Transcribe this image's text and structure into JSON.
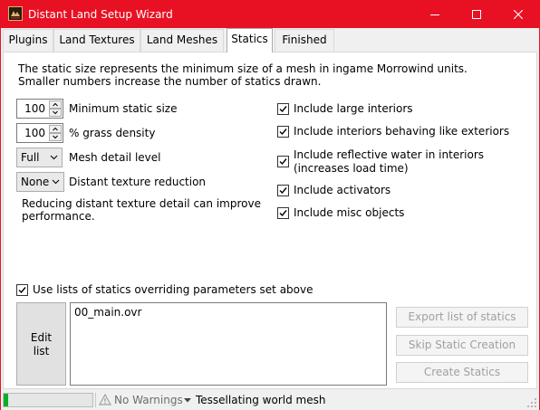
{
  "window": {
    "title": "Distant Land Setup Wizard",
    "icon": "app-icon",
    "accent_color": "#e81123",
    "controls": [
      "minimize-icon",
      "maximize-icon",
      "close-icon"
    ]
  },
  "tabs": [
    {
      "label": "Plugins",
      "active": false
    },
    {
      "label": "Land Textures",
      "active": false
    },
    {
      "label": "Land Meshes",
      "active": false
    },
    {
      "label": "Statics",
      "active": true
    },
    {
      "label": "Finished",
      "active": false
    }
  ],
  "statics": {
    "description_line1": "The static size represents the minimum size of a mesh in ingame Morrowind units.",
    "description_line2": "Smaller numbers increase the number of statics drawn.",
    "min_static_size": {
      "value": "100",
      "label": "Minimum static size"
    },
    "grass_density": {
      "value": "100",
      "label": "% grass density"
    },
    "mesh_detail": {
      "value": "Full",
      "label": "Mesh detail level"
    },
    "texture_reduction": {
      "value": "None",
      "label": "Distant texture reduction"
    },
    "reduction_note_line1": "Reducing distant texture detail can improve",
    "reduction_note_line2": "performance.",
    "options": [
      {
        "label": "Include large interiors",
        "checked": true
      },
      {
        "label": "Include interiors behaving like exteriors",
        "checked": true
      },
      {
        "label": "Include reflective water in interiors",
        "label2": "(increases load time)",
        "checked": true
      },
      {
        "label": "Include activators",
        "checked": true
      },
      {
        "label": "Include misc objects",
        "checked": true
      }
    ],
    "use_lists": {
      "label": "Use lists of statics overriding parameters set above",
      "checked": true
    },
    "edit_list": {
      "line1": "Edit",
      "line2": "list"
    },
    "list_items": [
      "00_main.ovr"
    ],
    "buttons": {
      "export": "Export list of statics",
      "skip": "Skip Static Creation",
      "create": "Create Statics"
    }
  },
  "status": {
    "progress": 0.05,
    "warnings": "No Warnings",
    "task": "Tessellating world mesh"
  }
}
